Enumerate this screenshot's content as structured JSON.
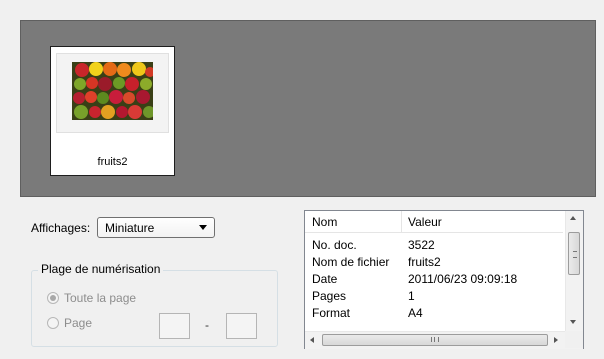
{
  "viewer": {
    "thumbnails": [
      {
        "label": "fruits2",
        "selected": true
      }
    ],
    "background_color": "#7a7a7a"
  },
  "view_mode": {
    "label": "Affichages:",
    "selected": "Miniature"
  },
  "scan_range": {
    "legend": "Plage de numérisation",
    "options": [
      {
        "label": "Toute la page",
        "checked": true,
        "enabled": false
      },
      {
        "label": "Page",
        "checked": false,
        "enabled": false
      }
    ],
    "separator": "-",
    "from_value": "",
    "to_value": ""
  },
  "properties": {
    "columns": [
      "Nom",
      "Valeur"
    ],
    "rows": [
      {
        "name": "No. doc.",
        "value": "3522"
      },
      {
        "name": "Nom de fichier",
        "value": "fruits2"
      },
      {
        "name": "Date",
        "value": "2011/06/23 09:09:18"
      },
      {
        "name": "Pages",
        "value": "1"
      },
      {
        "name": "Format",
        "value": "A4"
      }
    ],
    "hscroll_grip": "III"
  },
  "icons": {
    "dropdown": "chevron-down-icon",
    "scroll_up": "scroll-up-icon",
    "scroll_down": "scroll-down-icon",
    "scroll_left": "scroll-left-icon",
    "scroll_right": "scroll-right-icon"
  }
}
